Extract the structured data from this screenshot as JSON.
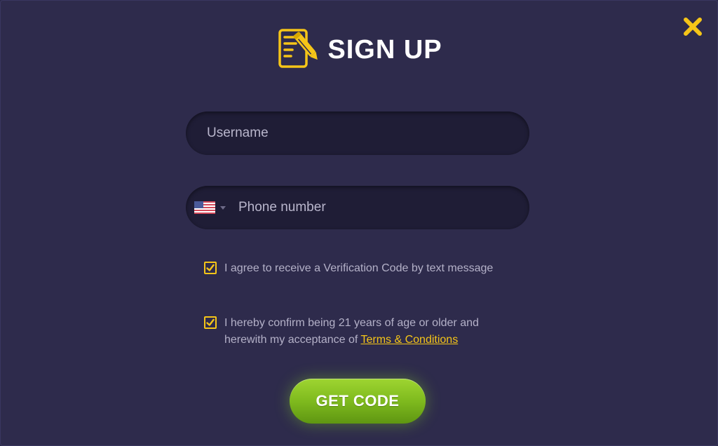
{
  "dialog": {
    "title": "SIGN UP"
  },
  "form": {
    "username": {
      "placeholder": "Username",
      "value": ""
    },
    "phone": {
      "placeholder": "Phone number",
      "value": "",
      "country_icon": "us-flag-icon"
    },
    "consent_sms": {
      "checked": true,
      "label": "I agree to receive a Verification Code by text message"
    },
    "consent_age": {
      "checked": true,
      "label_prefix": "I hereby confirm being 21 years of age or older and herewith my acceptance of ",
      "link_text": "Terms & Conditions"
    },
    "submit_label": "GET CODE"
  },
  "colors": {
    "background": "#2e2b4c",
    "field_background": "#1f1d36",
    "accent_yellow": "#f5c518",
    "button_green": "#7fba1e",
    "muted_text": "#b4b1c8"
  },
  "icons": {
    "header": "edit-document-icon",
    "close": "close-icon",
    "checkbox": "checkmark-icon"
  }
}
